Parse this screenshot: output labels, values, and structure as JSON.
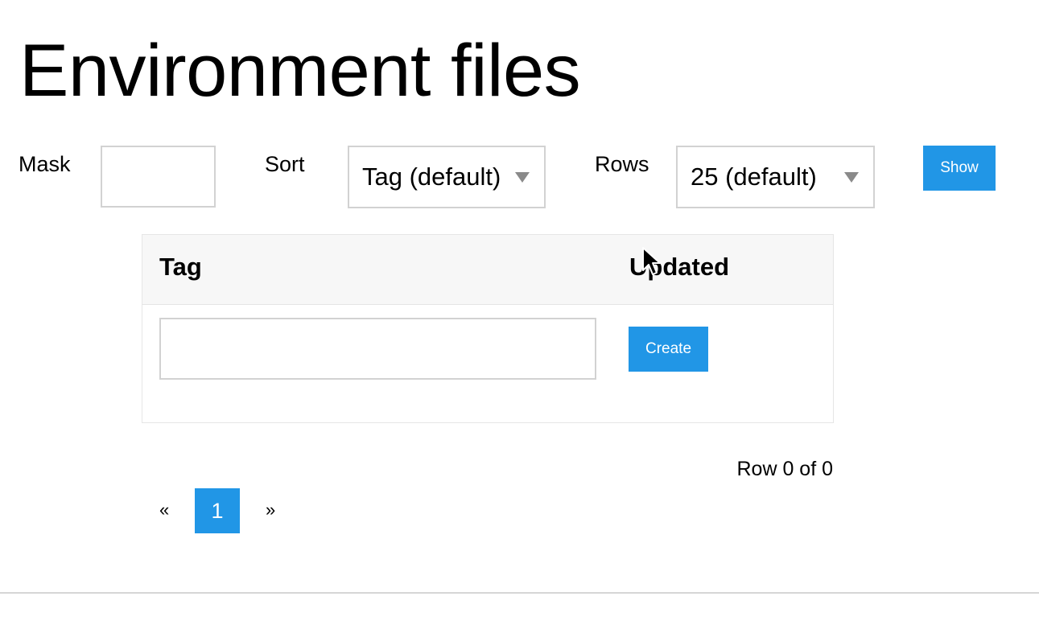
{
  "page": {
    "title": "Environment files"
  },
  "filters": {
    "mask_label": "Mask",
    "mask_value": "",
    "sort_label": "Sort",
    "sort_selected": "Tag (default)",
    "rows_label": "Rows",
    "rows_selected": "25 (default)",
    "show_button": "Show"
  },
  "table": {
    "columns": [
      "Tag",
      "Updated"
    ],
    "new_tag_value": "",
    "create_button": "Create",
    "rows": []
  },
  "pagination": {
    "row_count_text": "Row 0 of 0",
    "prev": "«",
    "current_page": "1",
    "next": "»"
  },
  "colors": {
    "accent": "#2196e6",
    "border": "#d2d2d2",
    "header_bg": "#f7f7f7"
  }
}
